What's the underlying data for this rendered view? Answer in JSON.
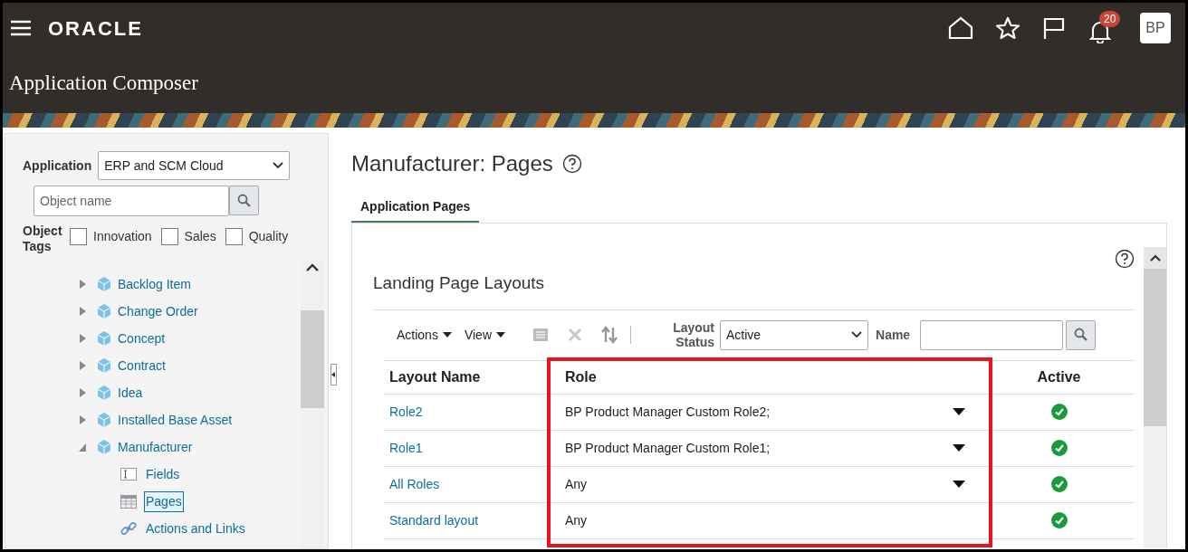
{
  "header": {
    "logo": "ORACLE",
    "title": "Application Composer",
    "notifications": "20",
    "avatar": "BP"
  },
  "sidebar": {
    "application_label": "Application",
    "application_value": "ERP and SCM Cloud",
    "search_placeholder": "Object name",
    "tags_label": "Object Tags",
    "tags": [
      {
        "label": "Innovation",
        "checked": false
      },
      {
        "label": "Sales",
        "checked": false
      },
      {
        "label": "Quality",
        "checked": false
      }
    ],
    "tree": [
      {
        "label": "Backlog Item",
        "expanded": false
      },
      {
        "label": "Change Order",
        "expanded": false
      },
      {
        "label": "Concept",
        "expanded": false
      },
      {
        "label": "Contract",
        "expanded": false
      },
      {
        "label": "Idea",
        "expanded": false
      },
      {
        "label": "Installed Base Asset",
        "expanded": false
      },
      {
        "label": "Manufacturer",
        "expanded": true,
        "children": [
          {
            "label": "Fields",
            "kind": "fields",
            "selected": false
          },
          {
            "label": "Pages",
            "kind": "pages",
            "selected": true
          },
          {
            "label": "Actions and Links",
            "kind": "links",
            "selected": false
          }
        ]
      }
    ]
  },
  "main": {
    "title": "Manufacturer: Pages",
    "tabs": [
      {
        "label": "Application Pages",
        "selected": true
      }
    ],
    "section_title": "Landing Page Layouts",
    "toolbar": {
      "actions": "Actions",
      "view": "View",
      "status_label": "Layout Status",
      "status_value": "Active",
      "name_label": "Name"
    },
    "table": {
      "columns": [
        "Layout Name",
        "Role",
        "Active"
      ],
      "rows": [
        {
          "name": "Role2",
          "role": "BP Product Manager Custom Role2;",
          "has_menu": true,
          "active": true
        },
        {
          "name": "Role1",
          "role": "BP Product Manager Custom Role1;",
          "has_menu": true,
          "active": true
        },
        {
          "name": "All Roles",
          "role": "Any",
          "has_menu": true,
          "active": true
        },
        {
          "name": "Standard layout",
          "role": "Any",
          "has_menu": false,
          "active": true
        }
      ]
    }
  }
}
